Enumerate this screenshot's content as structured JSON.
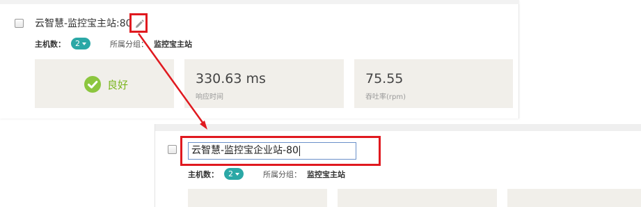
{
  "top_card": {
    "name": "云智慧-监控宝主站:80",
    "host_count_label": "主机数：",
    "host_count": "2",
    "group_label": "所属分组：",
    "group_value": "监控宝主站",
    "status": "良好",
    "metrics": [
      {
        "value": "330.63 ms",
        "label": "响应时间"
      },
      {
        "value": "75.55",
        "label": "吞吐率(rpm)"
      }
    ]
  },
  "bottom_card": {
    "name_input_value": "云智慧-监控宝企业站-80",
    "host_count_label": "主机数：",
    "host_count": "2",
    "group_label": "所属分组：",
    "group_value": "监控宝主站"
  },
  "colors": {
    "highlight": "#e0191f",
    "badge": "#2ba8a6",
    "status_good": "#8cc63f",
    "tile_bg": "#f1efea",
    "input_border": "#6a90c9"
  },
  "icons": [
    "pencil-icon",
    "check-circle-icon",
    "caret-down-icon"
  ]
}
